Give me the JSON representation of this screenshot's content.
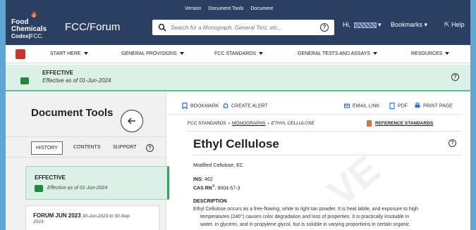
{
  "header": {
    "logo": {
      "line1": "Food",
      "line2": "Chemicals",
      "line3": "Codex",
      "line3_suffix": "FCC."
    },
    "title": "FCC/Forum",
    "top_links": [
      "Version",
      "Document Tools",
      "Document"
    ],
    "search_placeholder": "Search for a Monograph, General Test, etc...",
    "greeting": "Hi,",
    "bookmarks": "Bookmarks",
    "help": "Help"
  },
  "nav": {
    "items": [
      "START HERE",
      "GENERAL PROVISIONS",
      "FCC STANDARDS",
      "GENERAL TESTS AND ASSAYS",
      "RESOURCES"
    ]
  },
  "banner": {
    "status": "EFFECTIVE",
    "date": "Effective as of 01-Jun-2024"
  },
  "document_tools": {
    "title": "Document Tools",
    "tabs": [
      "HISTORY",
      "CONTENTS",
      "SUPPORT"
    ],
    "cards": [
      {
        "title": "EFFECTIVE",
        "subtitle": "Effective as of 01-Jun-2024"
      },
      {
        "title": "FORUM JUN 2023",
        "range": "30-Jun-2023 to 30-Sep-",
        "range_cont": "2023"
      }
    ]
  },
  "content": {
    "toolbar": {
      "bookmark": "BOOKMARK",
      "alert": "CREATE ALERT",
      "email": "EMAIL LINK",
      "pdf": "PDF",
      "print": "PRINT PAGE"
    },
    "breadcrumb": [
      "FCC STANDARDS",
      "MONOGRAPHS",
      "ETHYL CELLULOSE"
    ],
    "reference_standards": "REFERENCE STANDARDS",
    "title": "Ethyl Cellulose",
    "synonym": "Modified Cellulose, EC",
    "ins_label": "INS:",
    "ins_value": "462",
    "cas_label": "CAS RN",
    "cas_value": "9004-57-3",
    "description_heading": "DESCRIPTION",
    "description_lines": [
      "Ethyl Cellulose occurs as a free-flowing, white to light tan powder. It is heat labile, and exposure to high",
      "    temperatures (240°) causes color degradation and loss of properties. It is practically insoluble in",
      "    water, in glycerin, and in propylene glycol, but is soluble in varying proportions in certain organic"
    ],
    "watermark": "VE"
  },
  "colors": {
    "header_bg": "#2b3f63",
    "effective_green": "#1f8a3b",
    "banner_bg": "#dcf1e6",
    "home_red": "#c0392b"
  }
}
